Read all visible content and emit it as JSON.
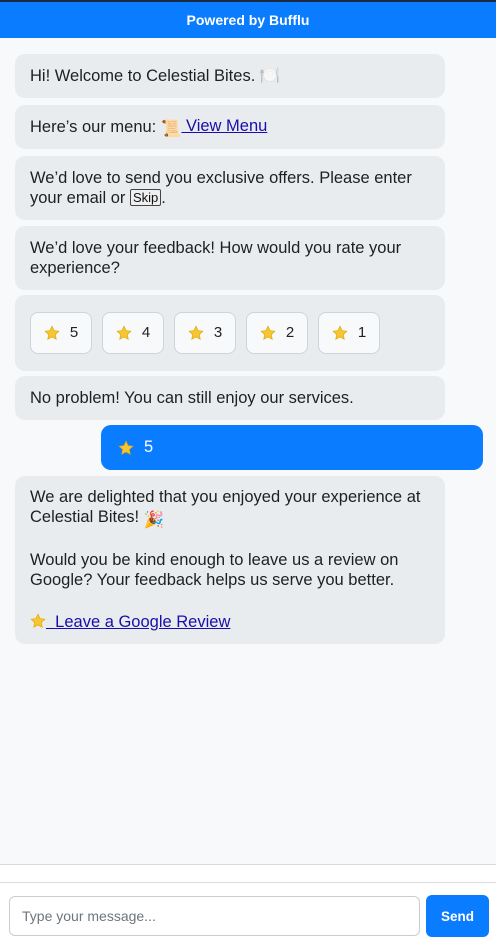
{
  "header": {
    "title": "Powered by Bufflu"
  },
  "messages": {
    "welcome": {
      "text": "Hi! Welcome to Celestial Bites.",
      "emoji": "🍽️"
    },
    "menu": {
      "text": "Here’s our menu:",
      "link_emoji": "📜",
      "link_text": "View Menu"
    },
    "offers": {
      "text": "We’d love to send you exclusive offers. Please enter your email or",
      "skip_label": "Skip",
      "end": "."
    },
    "feedback": {
      "text": "We’d love your feedback! How would you rate your experience?"
    },
    "rating_options": [
      "5",
      "4",
      "3",
      "2",
      "1"
    ],
    "no_problem": {
      "text": "No problem! You can still enjoy our services."
    },
    "user_reply": {
      "rating": "5"
    },
    "delighted": {
      "line1": "We are delighted that you enjoyed your experience at Celestial Bites!",
      "emoji": "🎉",
      "line2": "Would you be kind enough to leave us a review on Google? Your feedback helps us serve you better.",
      "link_text": "Leave a Google Review"
    }
  },
  "composer": {
    "placeholder": "Type your message...",
    "send_label": "Send"
  },
  "colors": {
    "accent": "#0a7cff",
    "bot_bubble": "#e9ecef",
    "star": "#f7c531",
    "link": "#1a0dab"
  },
  "icons": {
    "star": "star-icon"
  }
}
